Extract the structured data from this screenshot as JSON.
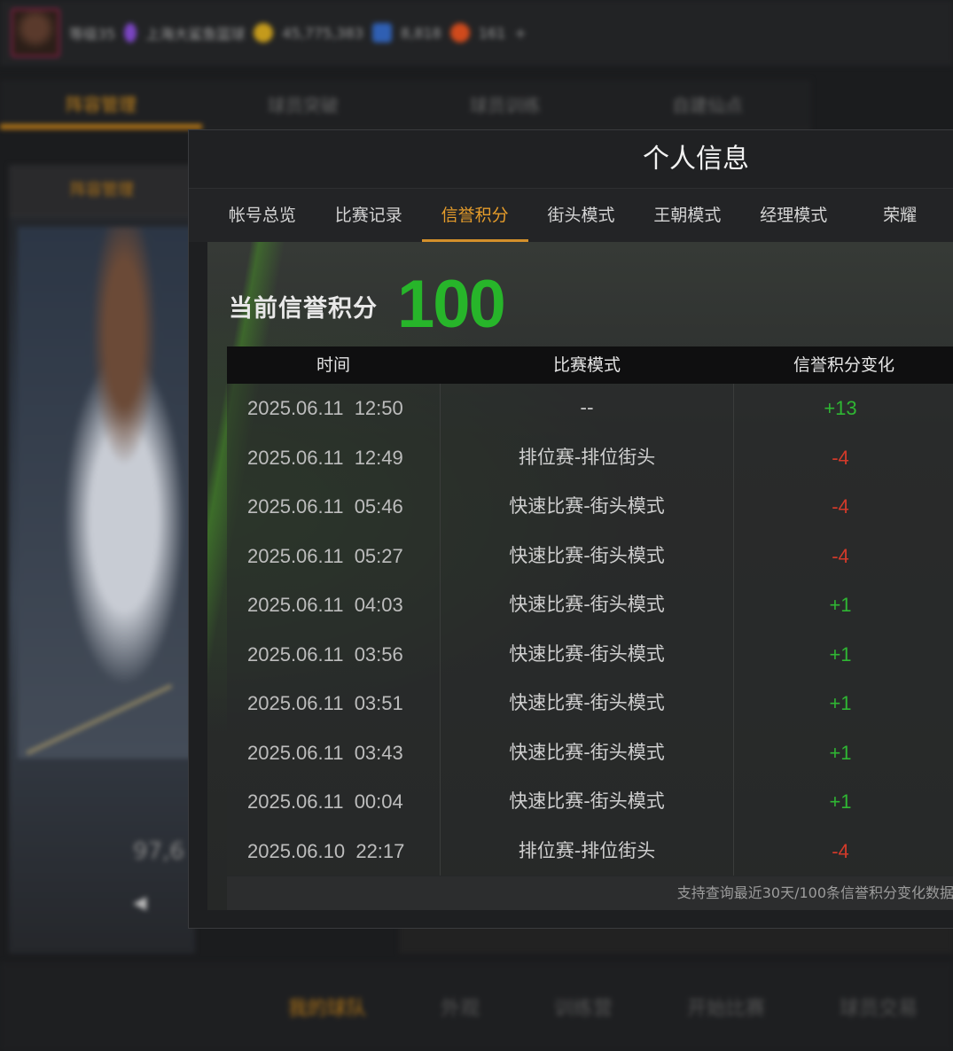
{
  "background": {
    "topbar": {
      "name": "等级35",
      "title": "上海大鲨鱼篮球",
      "gold": "45,775,383",
      "blue": "8,818",
      "red": "161",
      "plus": "+"
    },
    "tabs": [
      "阵容管理",
      "球员突破",
      "球员训练",
      "自建仙点"
    ],
    "left_panel": {
      "header": "阵容管理",
      "score": "97,6",
      "arrow": "◀"
    },
    "bottom_nav": [
      "我的球队",
      "外观",
      "训练营",
      "开始比赛",
      "球员交易"
    ]
  },
  "modal": {
    "title": "个人信息",
    "tabs": [
      "帐号总览",
      "比赛记录",
      "信誉积分",
      "街头模式",
      "王朝模式",
      "经理模式",
      "荣耀"
    ],
    "active_tab": 2,
    "score_label": "当前信誉积分",
    "score_value": "100",
    "table": {
      "headers": [
        "时间",
        "比赛模式",
        "信誉积分变化"
      ],
      "rows": [
        {
          "time": "2025.06.11  12:50",
          "mode": "--",
          "change": "+13",
          "sign": "pos"
        },
        {
          "time": "2025.06.11  12:49",
          "mode": "排位赛-排位街头",
          "change": "-4",
          "sign": "neg"
        },
        {
          "time": "2025.06.11  05:46",
          "mode": "快速比赛-街头模式",
          "change": "-4",
          "sign": "neg"
        },
        {
          "time": "2025.06.11  05:27",
          "mode": "快速比赛-街头模式",
          "change": "-4",
          "sign": "neg"
        },
        {
          "time": "2025.06.11  04:03",
          "mode": "快速比赛-街头模式",
          "change": "+1",
          "sign": "pos"
        },
        {
          "time": "2025.06.11  03:56",
          "mode": "快速比赛-街头模式",
          "change": "+1",
          "sign": "pos"
        },
        {
          "time": "2025.06.11  03:51",
          "mode": "快速比赛-街头模式",
          "change": "+1",
          "sign": "pos"
        },
        {
          "time": "2025.06.11  03:43",
          "mode": "快速比赛-街头模式",
          "change": "+1",
          "sign": "pos"
        },
        {
          "time": "2025.06.11  00:04",
          "mode": "快速比赛-街头模式",
          "change": "+1",
          "sign": "pos"
        },
        {
          "time": "2025.06.10  22:17",
          "mode": "排位赛-排位街头",
          "change": "-4",
          "sign": "neg"
        }
      ]
    },
    "footnote": "支持查询最近30天/100条信誉积分变化数据"
  },
  "colors": {
    "accent": "#e59c2b",
    "positive": "#2fb633",
    "negative": "#d23a2a",
    "score": "#27b52a"
  }
}
